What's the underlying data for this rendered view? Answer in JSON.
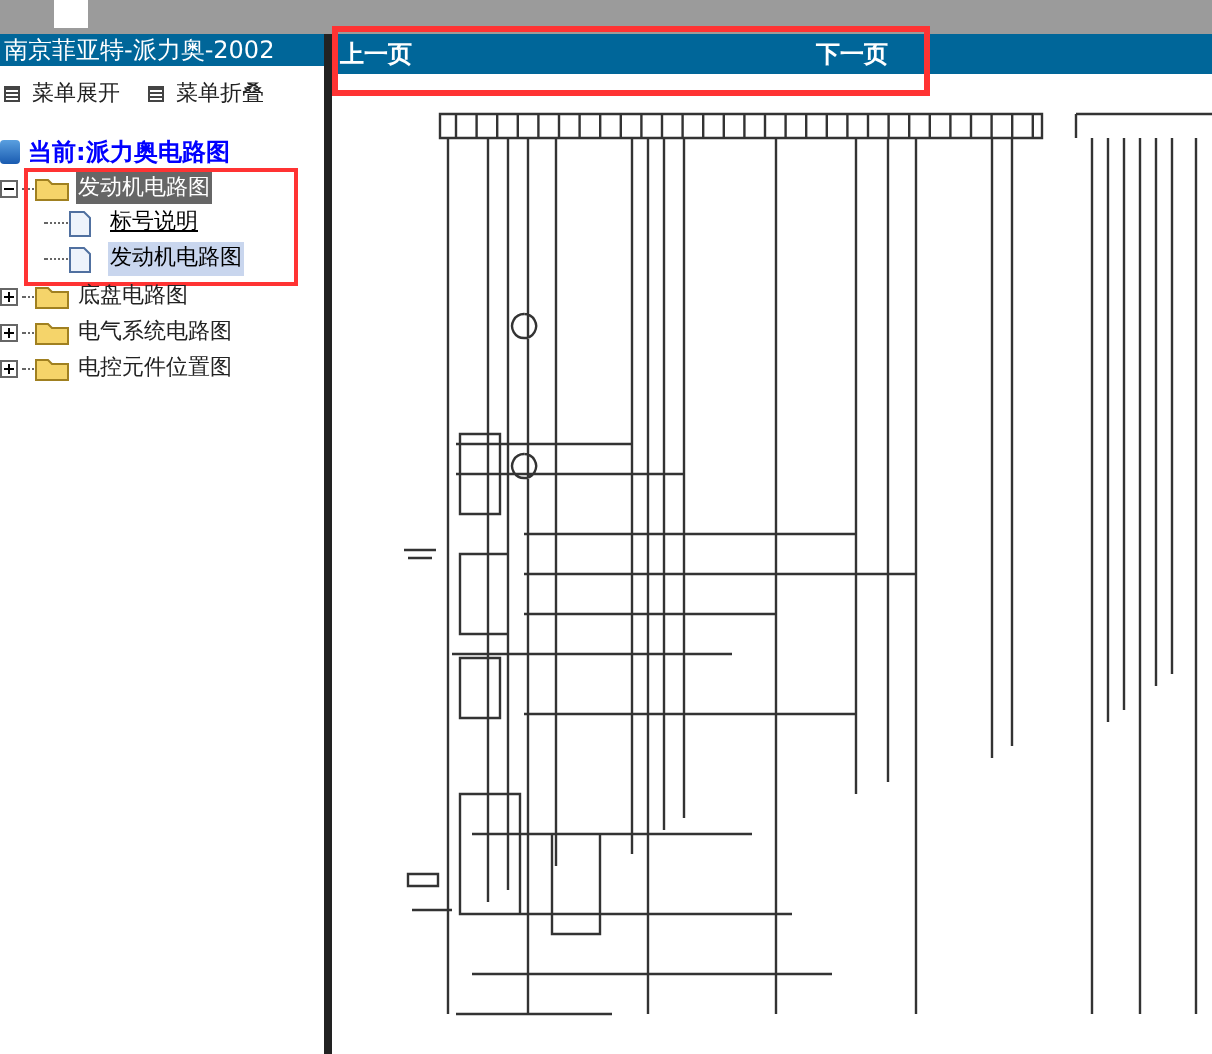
{
  "left_panel": {
    "title": "南京菲亚特-派力奥-2002",
    "menu_buttons": [
      {
        "label": "菜单展开"
      },
      {
        "label": "菜单折叠"
      }
    ],
    "tree": {
      "label": "当前:派力奥电路图",
      "children": [
        {
          "label": "发动机电路图",
          "kind": "folder",
          "expanded": true,
          "selected": true,
          "highlighted": true,
          "children": [
            {
              "label": "标号说明",
              "kind": "page",
              "selected": false,
              "link": true
            },
            {
              "label": "发动机电路图",
              "kind": "page",
              "selected": true,
              "link": false
            }
          ]
        },
        {
          "label": "底盘电路图",
          "kind": "folder",
          "expanded": false,
          "selected": false,
          "highlighted": false
        },
        {
          "label": "电气系统电路图",
          "kind": "folder",
          "expanded": false,
          "selected": false,
          "highlighted": false
        },
        {
          "label": "电控元件位置图",
          "kind": "folder",
          "expanded": false,
          "selected": false,
          "highlighted": false
        }
      ]
    }
  },
  "viewer": {
    "prev_page": "上一页",
    "next_page": "下一页",
    "highlighted": true
  }
}
